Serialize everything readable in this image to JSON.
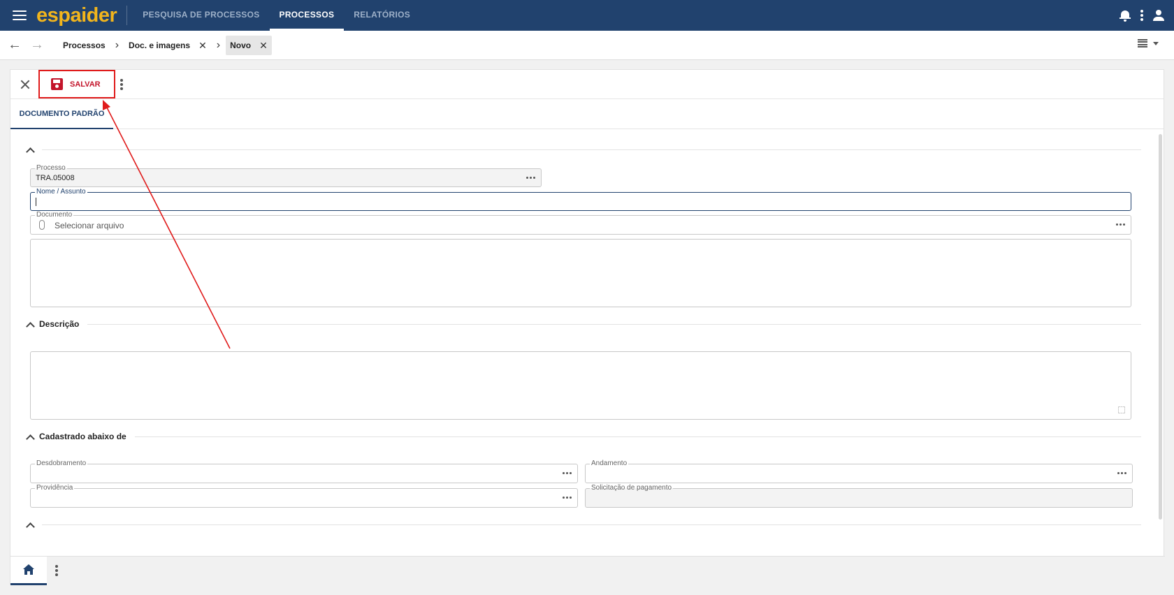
{
  "app": {
    "logo": "espaider"
  },
  "nav": {
    "tabs": [
      "PESQUISA DE PROCESSOS",
      "PROCESSOS",
      "RELATÓRIOS"
    ]
  },
  "breadcrumb": {
    "items": [
      "Processos",
      "Doc. e imagens",
      "Novo"
    ],
    "close_glyph": "✕"
  },
  "toolbar": {
    "save_label": "SALVAR"
  },
  "tabs": {
    "document": "DOCUMENTO PADRÃO"
  },
  "form": {
    "processo": {
      "label": "Processo",
      "value": "TRA.05008"
    },
    "nome": {
      "label": "Nome / Assunto",
      "value": ""
    },
    "documento": {
      "label": "Documento",
      "placeholder": "Selecionar arquivo"
    }
  },
  "sections": {
    "descricao": "Descrição",
    "cadastrado": "Cadastrado abaixo de"
  },
  "cadastrado_fields": {
    "desdobramento": "Desdobramento",
    "andamento": "Andamento",
    "providencia": "Providência",
    "solicitacao": "Solicitação de pagamento"
  },
  "icons": {
    "menu": "hamburger-icon",
    "bell": "bell-icon",
    "user": "user-icon",
    "save": "floppy-icon",
    "home": "home-icon",
    "attach": "paperclip-icon"
  },
  "colors": {
    "header": "#21426e",
    "logo": "#f2b51c",
    "annotation": "#e01b1b"
  }
}
